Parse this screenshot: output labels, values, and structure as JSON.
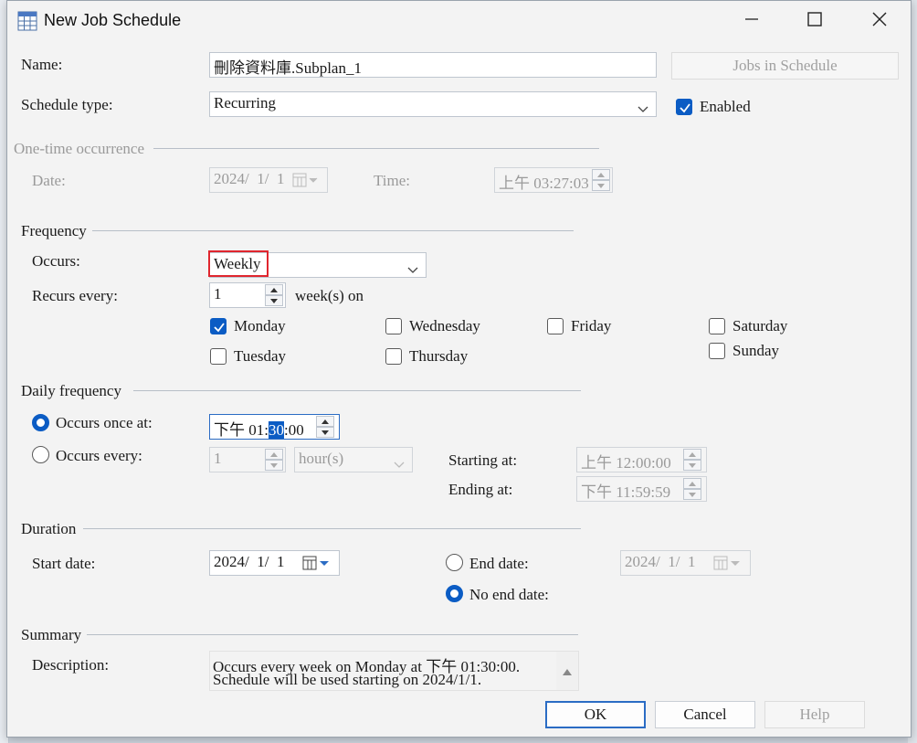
{
  "window": {
    "title": "New Job Schedule",
    "icon": "table-icon",
    "controls": [
      "minimize-icon",
      "maximize-icon",
      "close-icon"
    ]
  },
  "name_row": {
    "label": "Name:",
    "value": "刪除資料庫.Subplan_1",
    "jobs_button": "Jobs in Schedule"
  },
  "schedule_row": {
    "label": "Schedule type:",
    "value": "Recurring",
    "enabled_label": "Enabled",
    "enabled": true
  },
  "one_time": {
    "heading": "One-time occurrence",
    "date_label": "Date:",
    "date_value": "2024/  1/  1",
    "time_label": "Time:",
    "time_value": "上午 03:27:03"
  },
  "frequency": {
    "heading": "Frequency",
    "occurs_label": "Occurs:",
    "occurs_value": "Weekly",
    "recurs_label": "Recurs every:",
    "recurs_value": "1",
    "recurs_suffix": "week(s) on",
    "days": [
      {
        "label": "Monday",
        "checked": true
      },
      {
        "label": "Tuesday",
        "checked": false
      },
      {
        "label": "Wednesday",
        "checked": false
      },
      {
        "label": "Thursday",
        "checked": false
      },
      {
        "label": "Friday",
        "checked": false
      },
      {
        "label": "Saturday",
        "checked": false
      },
      {
        "label": "Sunday",
        "checked": false
      }
    ]
  },
  "daily": {
    "heading": "Daily frequency",
    "once_label": "Occurs once at:",
    "once_selected": true,
    "once_time_prefix": "下午 01:",
    "once_time_highlight": "30",
    "once_time_suffix": ":00",
    "every_label": "Occurs every:",
    "every_value": "1",
    "every_unit": "hour(s)",
    "starting_label": "Starting at:",
    "starting_value": "上午 12:00:00",
    "ending_label": "Ending at:",
    "ending_value": "下午 11:59:59"
  },
  "duration": {
    "heading": "Duration",
    "start_label": "Start date:",
    "start_value": "2024/  1/  1",
    "end_label": "End date:",
    "end_value": "2024/  1/  1",
    "no_end_label": "No end date:",
    "no_end_selected": true
  },
  "summary": {
    "heading": "Summary",
    "description_label": "Description:",
    "line1": "Occurs every week on Monday at 下午 01:30:00.",
    "line2": "Schedule will be used starting on 2024/1/1."
  },
  "buttons": {
    "ok": "OK",
    "cancel": "Cancel",
    "help": "Help"
  },
  "colors": {
    "accent": "#0b5cc4",
    "highlight_box": "#e0262e"
  }
}
